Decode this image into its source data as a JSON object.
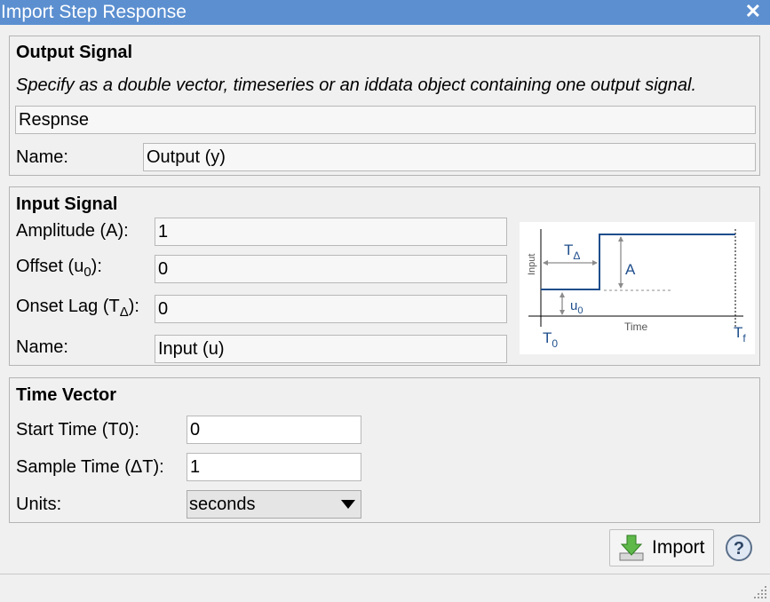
{
  "window": {
    "title": "Import Step Response",
    "close_glyph": "✕"
  },
  "output_signal": {
    "title": "Output Signal",
    "description": "Specify as a double vector, timeseries or an iddata object containing one output signal.",
    "value": "Respnse",
    "name_label": "Name:",
    "name_value": "Output (y)"
  },
  "input_signal": {
    "title": "Input Signal",
    "amplitude_label": "Amplitude (A):",
    "amplitude_value": "1",
    "offset_label_prefix": "Offset (u",
    "offset_label_sub": "0",
    "offset_label_suffix": "):",
    "offset_value": "0",
    "onset_label_prefix": "Onset Lag (T",
    "onset_label_sub": "Δ",
    "onset_label_suffix": "):",
    "onset_value": "0",
    "name_label": "Name:",
    "name_value": "Input (u)",
    "diagram": {
      "y_axis_label": "Input",
      "x_axis_label": "Time",
      "t0_main": "T",
      "t0_sub": "0",
      "tf_main": "T",
      "tf_sub": "f",
      "tdelta_main": "T",
      "tdelta_sub": "Δ",
      "amplitude_label": "A",
      "u0_main": "u",
      "u0_sub": "0"
    }
  },
  "time_vector": {
    "title": "Time Vector",
    "start_label": "Start Time (T0):",
    "start_value": "0",
    "sample_label": "Sample Time (ΔT):",
    "sample_value": "1",
    "units_label": "Units:",
    "units_value": "seconds"
  },
  "buttons": {
    "import_label": "Import",
    "help_glyph": "?"
  },
  "colors": {
    "titlebar": "#5b8fd0",
    "diagram_line": "#1f4e8c",
    "annotation": "#8c8c8c"
  }
}
